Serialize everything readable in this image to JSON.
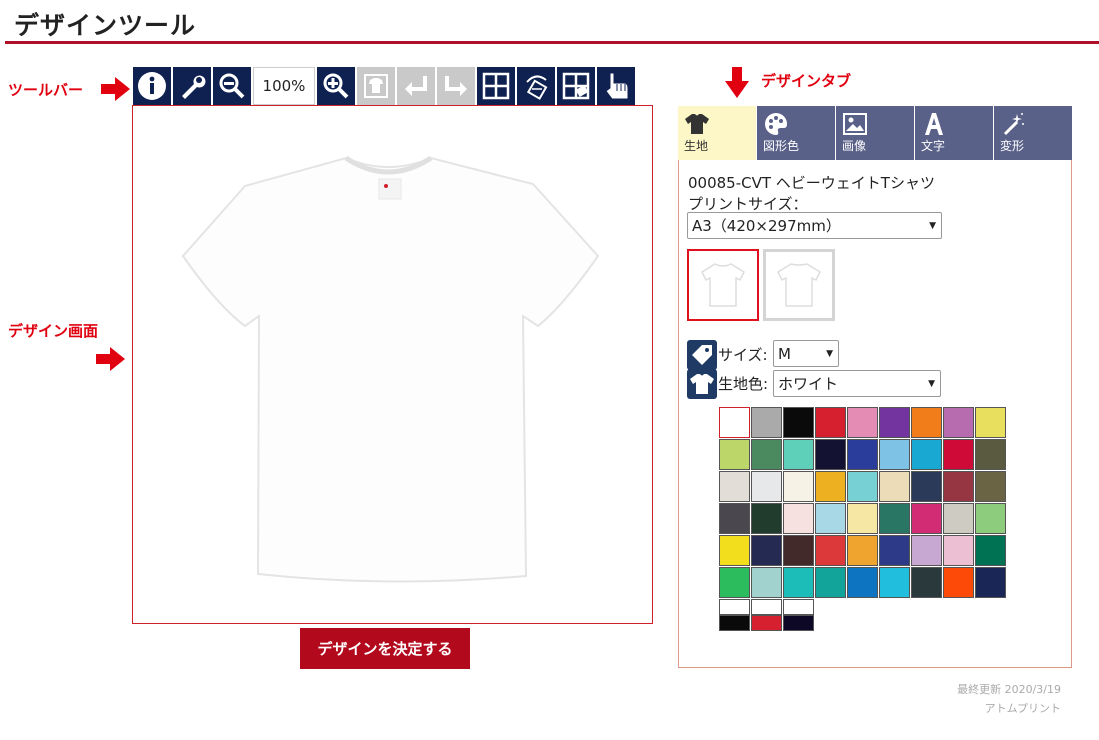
{
  "page": {
    "title": "デザインツール"
  },
  "callouts": {
    "toolbar": "ツールバー",
    "design_area": "デザイン画面",
    "design_tabs": "デザインタブ"
  },
  "toolbar": {
    "zoom_level": "100%",
    "buttons": [
      {
        "name": "info-icon",
        "enabled": true
      },
      {
        "name": "wrench-icon",
        "enabled": true
      },
      {
        "name": "zoom-out-icon",
        "enabled": true
      },
      {
        "name": "zoom-in-icon",
        "enabled": true
      },
      {
        "name": "tshirt-view-icon",
        "enabled": false
      },
      {
        "name": "undo-icon",
        "enabled": false
      },
      {
        "name": "redo-icon",
        "enabled": false
      },
      {
        "name": "grid-icon",
        "enabled": true
      },
      {
        "name": "rotate-icon",
        "enabled": true
      },
      {
        "name": "grid-eraser-icon",
        "enabled": true
      },
      {
        "name": "pointer-icon",
        "enabled": true
      }
    ]
  },
  "decide_button": "デザインを決定する",
  "tabs": [
    {
      "label": "生地",
      "icon": "tshirt-icon",
      "active": true
    },
    {
      "label": "図形色",
      "icon": "palette-icon",
      "active": false
    },
    {
      "label": "画像",
      "icon": "image-icon",
      "active": false
    },
    {
      "label": "文字",
      "icon": "text-icon",
      "active": false
    },
    {
      "label": "変形",
      "icon": "magic-wand-icon",
      "active": false
    }
  ],
  "product": {
    "name": "00085-CVT ヘビーウェイトTシャツ",
    "print_size_label": "プリントサイズ：",
    "print_size_value": "A3（420×297mm）",
    "size_label": "サイズ:",
    "size_value": "M",
    "color_label": "生地色:",
    "color_value": "ホワイト"
  },
  "thumbnails": [
    {
      "name": "front-view",
      "selected": true
    },
    {
      "name": "back-view",
      "selected": false
    }
  ],
  "palette": {
    "rows": [
      [
        "#ffffff",
        "#aaaaaa",
        "#0a0a0a",
        "#d7202f",
        "#e48cb4",
        "#7434a0",
        "#f07c1a",
        "#b86cb0",
        "#e8df5e"
      ],
      [
        "#bcd66a",
        "#4a8a5e",
        "#5ecfb8",
        "#141232",
        "#2b3d9a",
        "#7ec3e6",
        "#18a8d2",
        "#cf0a36",
        "#5a5a40"
      ],
      [
        "#e2ddd6",
        "#e6e8ea",
        "#f6f2e6",
        "#ecb020",
        "#76d0d4",
        "#ecdcb8",
        "#2a3a58",
        "#963642",
        "#6a6444"
      ],
      [
        "#4a484e",
        "#213c2c",
        "#f6e0e0",
        "#a8d8e6",
        "#f6e8a4",
        "#2a7664",
        "#d22c74",
        "#cdcbc2",
        "#8ccc7c"
      ],
      [
        "#f2de1c",
        "#242a52",
        "#432a2a",
        "#dc3a3a",
        "#f0a430",
        "#2c3a88",
        "#c6a8d2",
        "#ecc0d2",
        "#007254"
      ],
      [
        "#2cbc5e",
        "#a2d2ce",
        "#1cbcb8",
        "#12a39a",
        "#0c74c0",
        "#22bede",
        "#2a3a3c",
        "#fe4a08",
        "#192656"
      ]
    ],
    "extra": [
      {
        "top": "#ffffff",
        "bottom": "#0a0a0a"
      },
      {
        "top": "#ffffff",
        "bottom": "#d7202f"
      },
      {
        "top": "#ffffff",
        "bottom": "#0c0826"
      }
    ]
  },
  "footer": {
    "updated": "最終更新 2020/3/19",
    "company": "アトムプリント"
  }
}
